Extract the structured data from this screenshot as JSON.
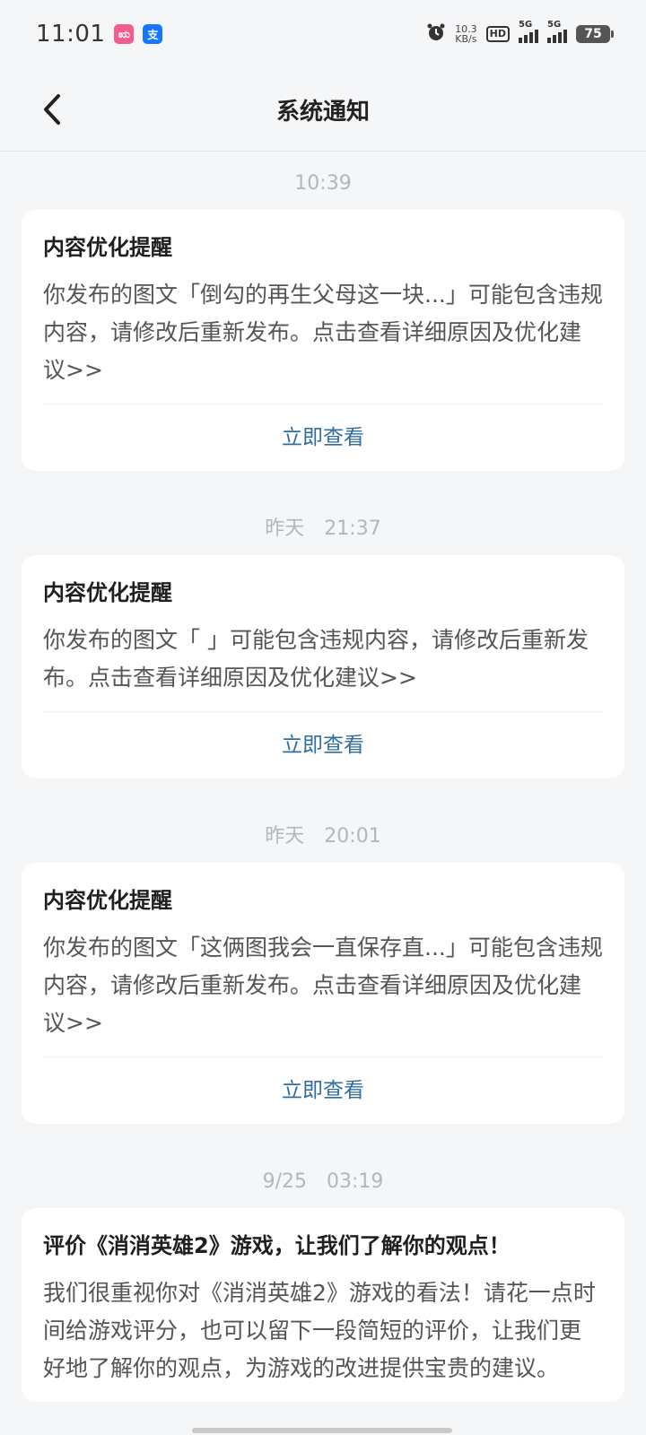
{
  "status_bar": {
    "time": "11:01",
    "app_badges": [
      "ಋ",
      "支"
    ],
    "net_speed_value": "10.3",
    "net_speed_unit": "KB/s",
    "hd_label": "HD",
    "sim1_label": "5G",
    "sim2_label": "5G",
    "battery": "75"
  },
  "nav": {
    "title": "系统通知"
  },
  "notifications": [
    {
      "time": "10:39",
      "title": "内容优化提醒",
      "body": "你发布的图文「倒勾的再生父母这一块...」可能包含违规内容，请修改后重新发布。点击查看详细原因及优化建议>>",
      "action": "立即查看"
    },
    {
      "time": "昨天　21:37",
      "title": "内容优化提醒",
      "body": "你发布的图文「 」可能包含违规内容，请修改后重新发布。点击查看详细原因及优化建议>>",
      "action": "立即查看"
    },
    {
      "time": "昨天　20:01",
      "title": "内容优化提醒",
      "body": "你发布的图文「这俩图我会一直保存直...」可能包含违规内容，请修改后重新发布。点击查看详细原因及优化建议>>",
      "action": "立即查看"
    },
    {
      "time": "9/25　03:19",
      "title": "评价《消消英雄2》游戏，让我们了解你的观点！",
      "body": "我们很重视你对《消消英雄2》游戏的看法！请花一点时间给游戏评分，也可以留下一段简短的评价，让我们更好地了解你的观点，为游戏的改进提供宝贵的建议。"
    }
  ],
  "colors": {
    "background": "#f5f6f8",
    "card": "#ffffff",
    "action_link": "#2f6e9e",
    "timestamp": "#b3b6bb"
  }
}
